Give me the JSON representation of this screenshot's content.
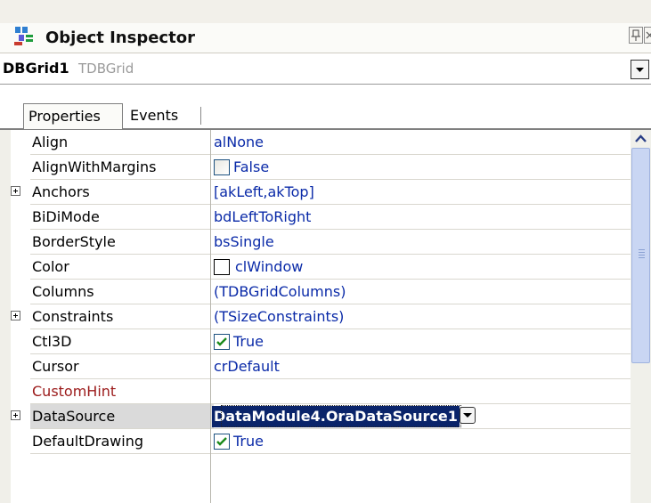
{
  "window": {
    "title": "Object Inspector",
    "title_icon": "object-inspector-icon",
    "pin_icon": "pin-icon",
    "close_icon": "close-icon"
  },
  "component_selector": {
    "name": "DBGrid1",
    "type": "TDBGrid"
  },
  "tabs": [
    {
      "label": "Properties",
      "active": true
    },
    {
      "label": "Events",
      "active": false
    }
  ],
  "properties": [
    {
      "name": "Align",
      "value": "alNone",
      "expandable": false
    },
    {
      "name": "AlignWithMargins",
      "value": "False",
      "checkbox": "unchecked",
      "expandable": false
    },
    {
      "name": "Anchors",
      "value": "[akLeft,akTop]",
      "expandable": true
    },
    {
      "name": "BiDiMode",
      "value": "bdLeftToRight",
      "expandable": false
    },
    {
      "name": "BorderStyle",
      "value": "bsSingle",
      "expandable": false
    },
    {
      "name": "Color",
      "value": "clWindow",
      "swatch": "#ffffff",
      "expandable": false
    },
    {
      "name": "Columns",
      "value": "(TDBGridColumns)",
      "expandable": false
    },
    {
      "name": "Constraints",
      "value": "(TSizeConstraints)",
      "expandable": true
    },
    {
      "name": "Ctl3D",
      "value": "True",
      "checkbox": "checked",
      "expandable": false
    },
    {
      "name": "Cursor",
      "value": "crDefault",
      "expandable": false
    },
    {
      "name": "CustomHint",
      "value": "",
      "expandable": false,
      "highlight_color": "#9b1a1a"
    },
    {
      "name": "DataSource",
      "value": "DataModule4.OraDataSource1",
      "expandable": true,
      "selected": true
    },
    {
      "name": "DefaultDrawing",
      "value": "True",
      "checkbox": "checked",
      "expandable": false
    }
  ],
  "colors": {
    "value_text": "#0a2aa8",
    "selection_bg": "#0a246a",
    "checkmark": "#1a8a1a",
    "scroll_thumb": "#c9d6f3"
  }
}
